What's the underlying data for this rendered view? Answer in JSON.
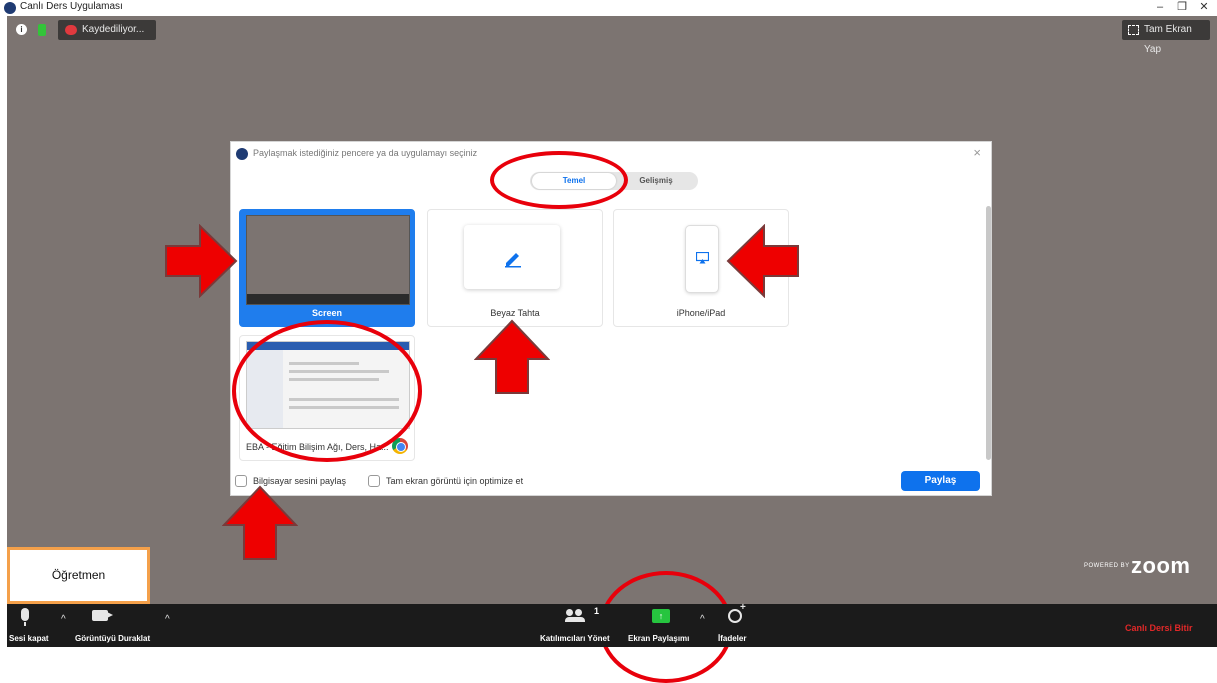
{
  "window": {
    "title": "Canlı Ders Uygulaması",
    "controls": [
      "–",
      "❐",
      "✕"
    ]
  },
  "meeting": {
    "recording_label": "Kaydediliyor...",
    "fullscreen_label": "Tam Ekran Yap",
    "powered_by_small": "POWERED BY",
    "powered_by_brand": "zoom",
    "teacher_name": "Öğretmen"
  },
  "share_dialog": {
    "title": "Paylaşmak istediğiniz pencere ya da uygulamayı seçiniz",
    "close": "×",
    "tabs": [
      {
        "label": "Temel",
        "selected": true
      },
      {
        "label": "Gelişmiş",
        "selected": false
      }
    ],
    "tiles": [
      {
        "label": "Screen",
        "selected": true
      },
      {
        "label": "Beyaz Tahta",
        "selected": false
      },
      {
        "label": "iPhone/iPad",
        "selected": false
      },
      {
        "label": "EBA - Eğitim Bilişim Ağı, Ders, Ha...",
        "selected": false
      }
    ],
    "options": [
      {
        "label": "Bilgisayar sesini paylaş",
        "checked": false
      },
      {
        "label": "Tam ekran görüntü için optimize et",
        "checked": false
      }
    ],
    "share_button": "Paylaş"
  },
  "toolbar": {
    "mute_label": "Sesi kapat",
    "video_label": "Görüntüyü Duraklat",
    "participants_label": "Katılımcıları Yönet",
    "participant_count": "1",
    "share_label": "Ekran Paylaşımı",
    "reactions_label": "İfadeler",
    "caret": "^",
    "end_label": "Canlı Dersi Bitir"
  },
  "colors": {
    "video_bg": "#7c7471",
    "accent_blue": "#0e72ed",
    "share_green": "#26c53f",
    "annotation_red": "#e8000b",
    "teacher_border": "#f4a04a",
    "end_red": "#e02828"
  }
}
